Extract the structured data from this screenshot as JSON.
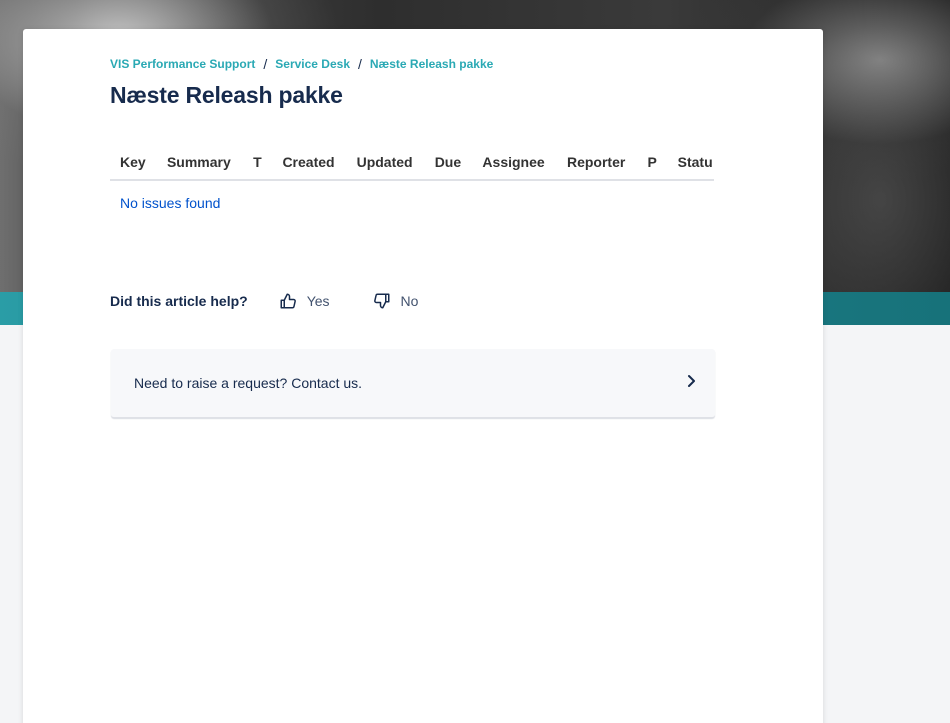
{
  "breadcrumb": [
    {
      "label": "VIS Performance Support"
    },
    {
      "label": "Service Desk"
    },
    {
      "label": "Næste Releash pakke"
    }
  ],
  "page": {
    "title": "Næste Releash pakke"
  },
  "issue_table": {
    "columns": [
      "Key",
      "Summary",
      "T",
      "Created",
      "Updated",
      "Due",
      "Assignee",
      "Reporter",
      "P",
      "Statu"
    ],
    "empty_message": "No issues found"
  },
  "feedback": {
    "question": "Did this article help?",
    "yes_label": "Yes",
    "no_label": "No"
  },
  "contact": {
    "text": "Need to raise a request? Contact us."
  },
  "icons": {
    "thumbs_up": "thumbs-up-icon",
    "thumbs_down": "thumbs-down-icon",
    "chevron_right": "chevron-right-icon"
  },
  "colors": {
    "breadcrumb_link": "#2aa9b4",
    "title": "#172b4d",
    "empty_link": "#0052cc",
    "band": "#1c7f88"
  }
}
